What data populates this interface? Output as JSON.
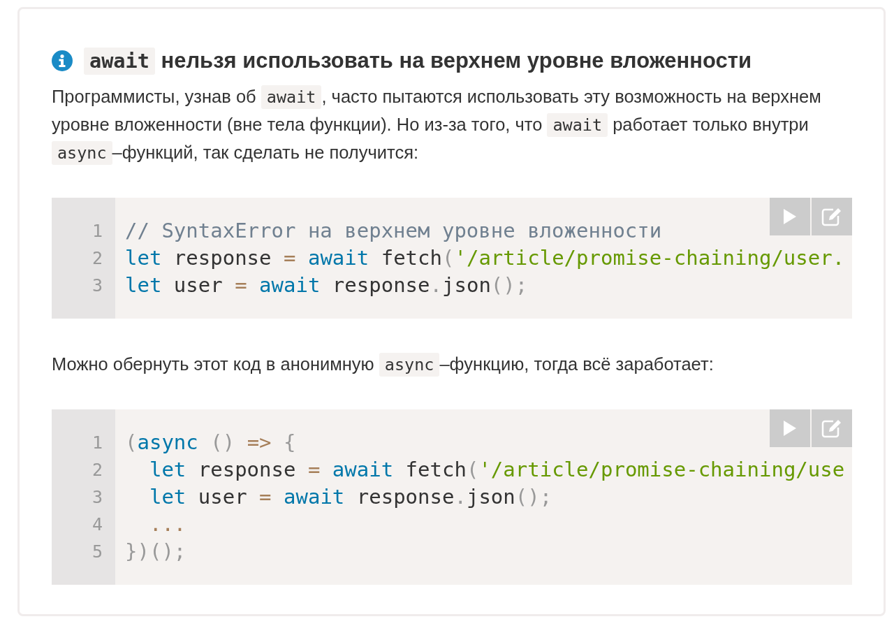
{
  "note": {
    "title": [
      {
        "kind": "code",
        "text": "await"
      },
      {
        "kind": "text",
        "text": " нельзя использовать на верхнем уровне вложенности"
      }
    ],
    "blocks": [
      {
        "kind": "paragraph",
        "segments": [
          {
            "kind": "text",
            "text": "Программисты, узнав об "
          },
          {
            "kind": "code",
            "text": "await"
          },
          {
            "kind": "text",
            "text": ", часто пытаются использовать эту возможность на верхнем уровне вложенности (вне тела функции). Но из-за того, что "
          },
          {
            "kind": "code",
            "text": "await"
          },
          {
            "kind": "text",
            "text": " работает только внутри "
          },
          {
            "kind": "code",
            "text": "async"
          },
          {
            "kind": "text",
            "text": "–функций, так сделать не получится:"
          }
        ]
      },
      {
        "kind": "code",
        "lines": [
          {
            "number": "1",
            "tokens": [
              {
                "kind": "comment",
                "text": "// SyntaxError на верхнем уровне вложенности"
              }
            ]
          },
          {
            "number": "2",
            "tokens": [
              {
                "kind": "keyword",
                "text": "let"
              },
              {
                "kind": "plain",
                "text": " response "
              },
              {
                "kind": "operator",
                "text": "="
              },
              {
                "kind": "keyword",
                "text": " await"
              },
              {
                "kind": "plain",
                "text": " fetch"
              },
              {
                "kind": "punct",
                "text": "("
              },
              {
                "kind": "string",
                "text": "'/article/promise-chaining/user."
              }
            ]
          },
          {
            "number": "3",
            "tokens": [
              {
                "kind": "keyword",
                "text": "let"
              },
              {
                "kind": "plain",
                "text": " user "
              },
              {
                "kind": "operator",
                "text": "="
              },
              {
                "kind": "keyword",
                "text": " await"
              },
              {
                "kind": "plain",
                "text": " response"
              },
              {
                "kind": "punct",
                "text": "."
              },
              {
                "kind": "plain",
                "text": "json"
              },
              {
                "kind": "punct",
                "text": "();"
              }
            ]
          }
        ]
      },
      {
        "kind": "paragraph",
        "segments": [
          {
            "kind": "text",
            "text": "Можно обернуть этот код в анонимную "
          },
          {
            "kind": "code",
            "text": "async"
          },
          {
            "kind": "text",
            "text": "–функцию, тогда всё заработает:"
          }
        ]
      },
      {
        "kind": "code",
        "lines": [
          {
            "number": "1",
            "tokens": [
              {
                "kind": "punct",
                "text": "("
              },
              {
                "kind": "keyword",
                "text": "async"
              },
              {
                "kind": "punct",
                "text": " ()"
              },
              {
                "kind": "operator",
                "text": " =>"
              },
              {
                "kind": "punct",
                "text": " {"
              }
            ]
          },
          {
            "number": "2",
            "tokens": [
              {
                "kind": "keyword",
                "text": "  let"
              },
              {
                "kind": "plain",
                "text": " response "
              },
              {
                "kind": "operator",
                "text": "="
              },
              {
                "kind": "keyword",
                "text": " await"
              },
              {
                "kind": "plain",
                "text": " fetch"
              },
              {
                "kind": "punct",
                "text": "("
              },
              {
                "kind": "string",
                "text": "'/article/promise-chaining/use"
              }
            ]
          },
          {
            "number": "3",
            "tokens": [
              {
                "kind": "keyword",
                "text": "  let"
              },
              {
                "kind": "plain",
                "text": " user "
              },
              {
                "kind": "operator",
                "text": "="
              },
              {
                "kind": "keyword",
                "text": " await"
              },
              {
                "kind": "plain",
                "text": " response"
              },
              {
                "kind": "punct",
                "text": "."
              },
              {
                "kind": "plain",
                "text": "json"
              },
              {
                "kind": "punct",
                "text": "();"
              }
            ]
          },
          {
            "number": "4",
            "tokens": [
              {
                "kind": "operator",
                "text": "  ..."
              }
            ]
          },
          {
            "number": "5",
            "tokens": [
              {
                "kind": "punct",
                "text": "})();"
              }
            ]
          }
        ]
      }
    ]
  }
}
